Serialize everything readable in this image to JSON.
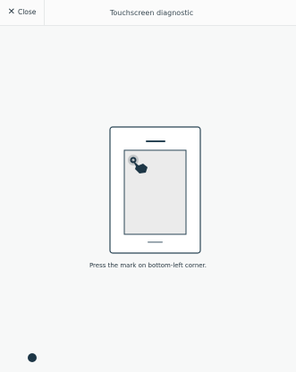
{
  "header": {
    "close_icon": "close-icon",
    "close_label": "Close",
    "title": "Touchscreen diagnostic"
  },
  "main": {
    "illustration_icon": "tablet-touch-icon",
    "instruction": "Press the mark on bottom-left corner."
  },
  "colors": {
    "dark_accent": "#1d3646",
    "background": "#f7f8f8",
    "screen_fill": "#ebebeb"
  }
}
